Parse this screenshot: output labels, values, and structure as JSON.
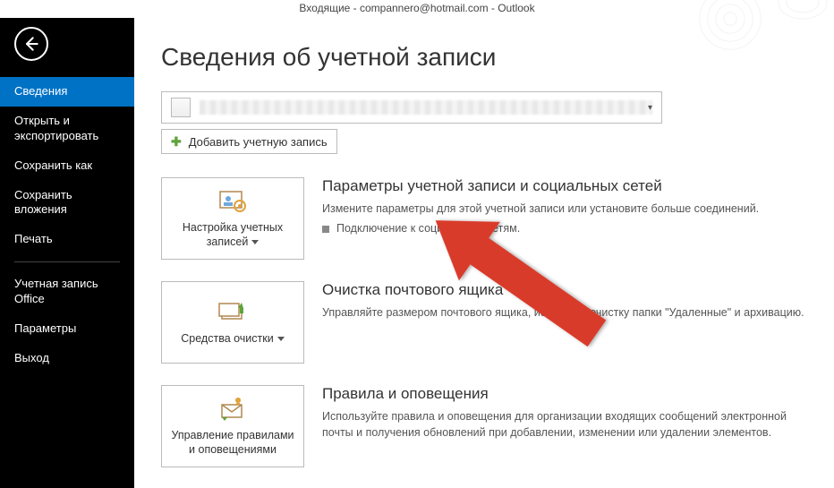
{
  "window_title": "Входящие - compannero@hotmail.com - Outlook",
  "sidebar": {
    "items": [
      {
        "label": "Сведения",
        "active": true
      },
      {
        "label": "Открыть и экспортировать"
      },
      {
        "label": "Сохранить как"
      },
      {
        "label": "Сохранить вложения"
      },
      {
        "label": "Печать"
      }
    ],
    "lower": [
      {
        "label": "Учетная запись Office"
      },
      {
        "label": "Параметры"
      },
      {
        "label": "Выход"
      }
    ]
  },
  "page_heading": "Сведения об учетной записи",
  "add_account_label": "Добавить учетную запись",
  "cards": [
    {
      "button_label": "Настройка учетных записей",
      "title": "Параметры учетной записи и социальных сетей",
      "desc": "Измените параметры для этой учетной записи или установите больше соединений.",
      "sub": "Подключение к социальным сетям."
    },
    {
      "button_label": "Средства очистки",
      "title": "Очистка почтового ящика",
      "desc": "Управляйте размером почтового ящика, используя очистку папки \"Удаленные\" и архивацию."
    },
    {
      "button_label": "Управление правилами и оповещениями",
      "title": "Правила и оповещения",
      "desc": "Используйте правила и оповещения для организации входящих сообщений электронной почты и получения обновлений при добавлении, изменении или удалении элементов."
    }
  ]
}
